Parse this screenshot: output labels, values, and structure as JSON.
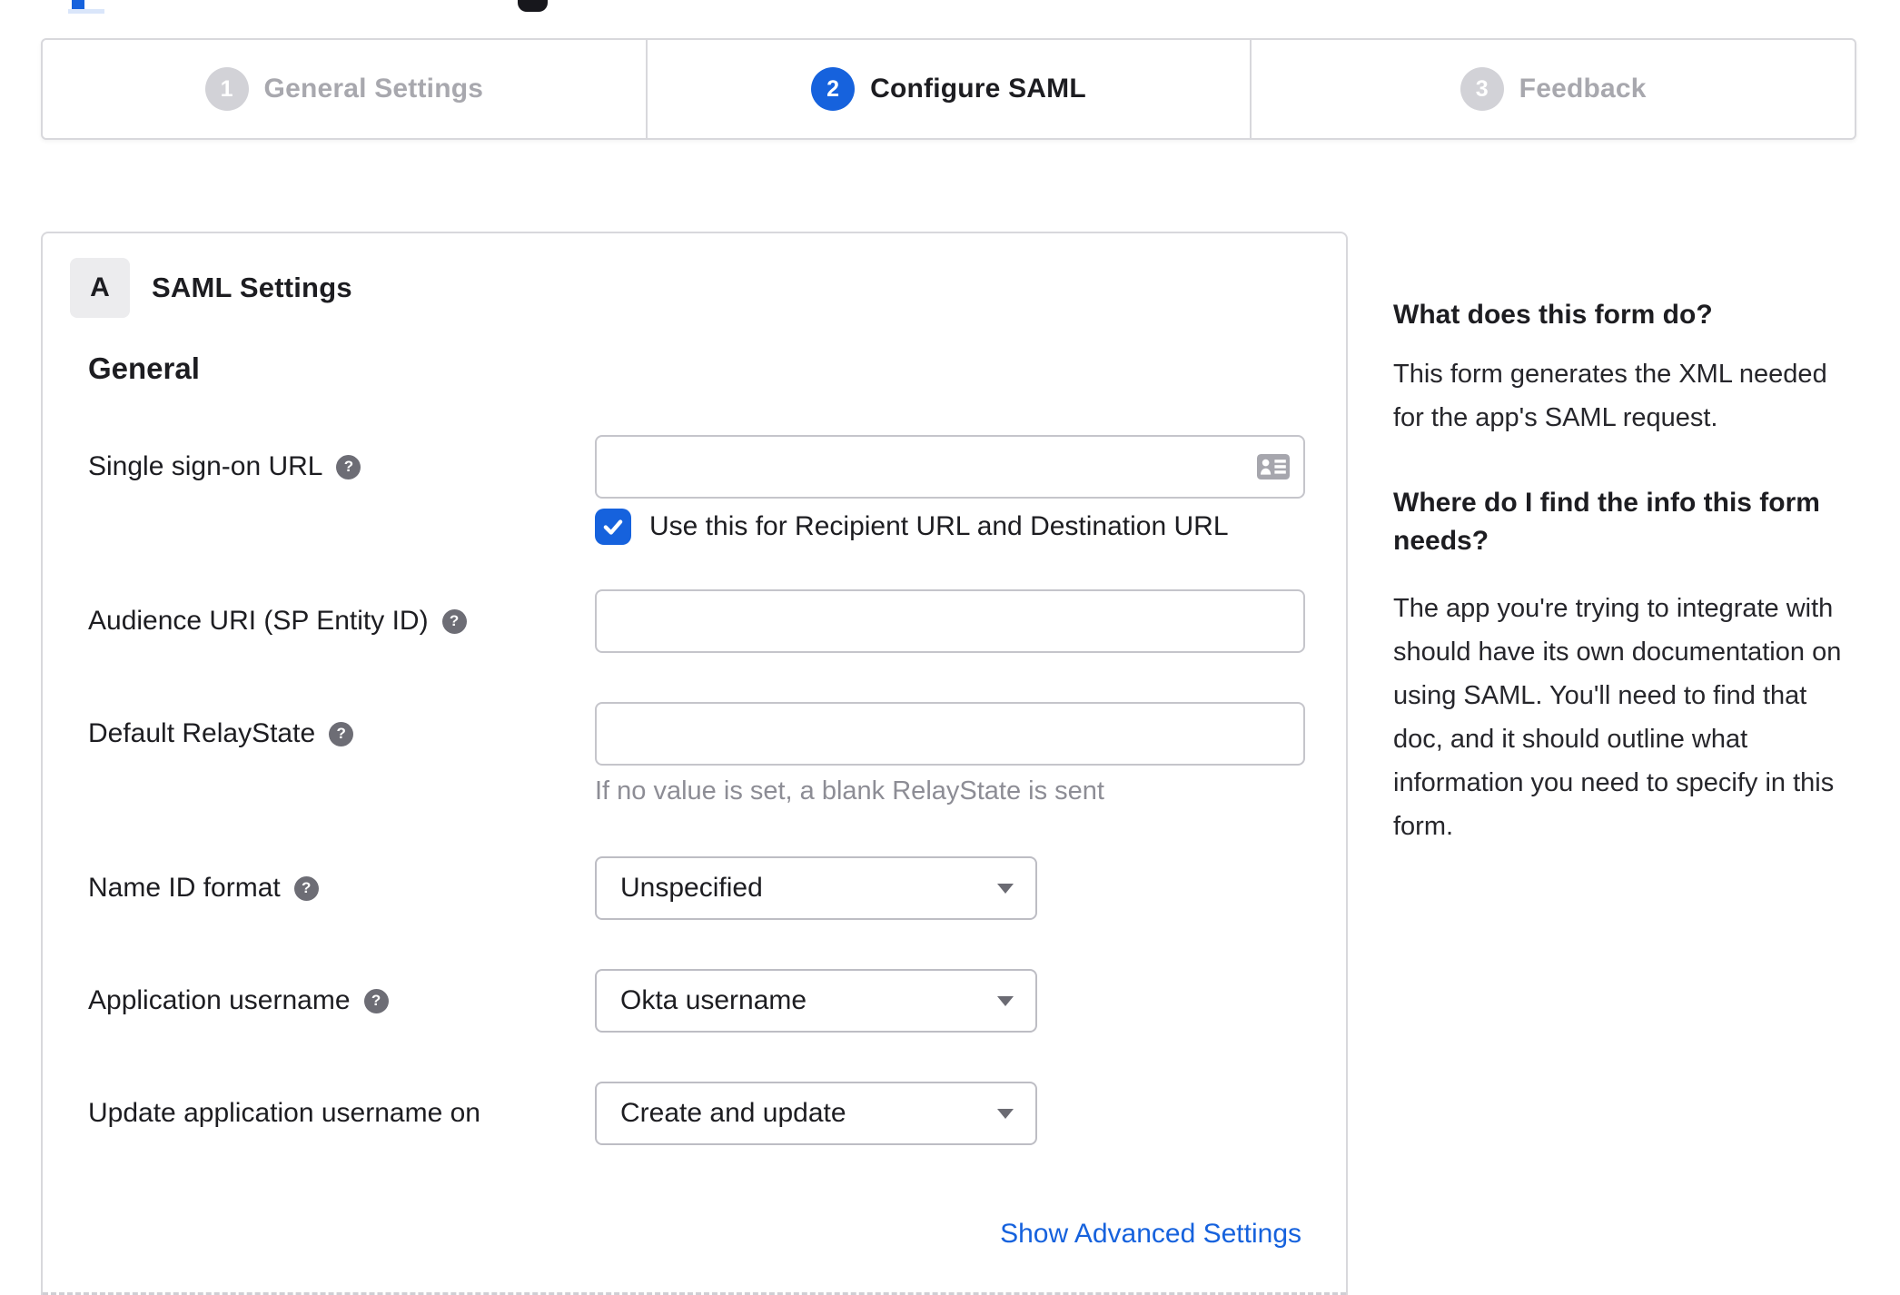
{
  "glyphs": {
    "help": "?"
  },
  "stepper": {
    "active_step": 2,
    "steps": [
      {
        "number": "1",
        "label": "General Settings"
      },
      {
        "number": "2",
        "label": "Configure SAML"
      },
      {
        "number": "3",
        "label": "Feedback"
      }
    ]
  },
  "card": {
    "badge": "A",
    "title": "SAML Settings",
    "section": "General",
    "fields": [
      {
        "label": "Single sign-on URL",
        "type": "text",
        "value": "",
        "icon": "contact-card-icon",
        "checkbox_label": "Use this for Recipient URL and Destination URL",
        "checkbox_checked": true
      },
      {
        "label": "Audience URI (SP Entity ID)",
        "type": "text",
        "value": ""
      },
      {
        "label": "Default RelayState",
        "type": "text",
        "value": "",
        "hint": "If no value is set, a blank RelayState is sent"
      },
      {
        "label": "Name ID format",
        "type": "select",
        "value": "Unspecified"
      },
      {
        "label": "Application username",
        "type": "select",
        "value": "Okta username"
      },
      {
        "label": "Update application username on",
        "type": "select",
        "value": "Create and update"
      }
    ],
    "advanced_link": "Show Advanced Settings"
  },
  "help_panel": {
    "q1": "What does this form do?",
    "a1": "This form generates the XML needed for the app's SAML request.",
    "a1_lines": [
      "This form generates the XML needed",
      "for the app's SAML request."
    ],
    "q2": "Where do I find the info this form needs?",
    "q2_lines": [
      "Where do I find the info this form",
      "needs?"
    ],
    "a2": "The app you're trying to integrate with should have its own documentation on using SAML. You'll need to find that doc, and it should outline what information you need to specify in this form.",
    "a2_lines": [
      "The app you're trying to integrate with",
      "should have its own documentation on",
      "using SAML. You'll need to find that",
      "doc, and it should outline what",
      "information you need to specify in this",
      "form."
    ]
  },
  "colors": {
    "accent": "#1662dd",
    "border": "#d8d8dc",
    "inactive_gray": "#d2d2d7",
    "text": "#1d1d21",
    "muted": "#8d8d95"
  }
}
